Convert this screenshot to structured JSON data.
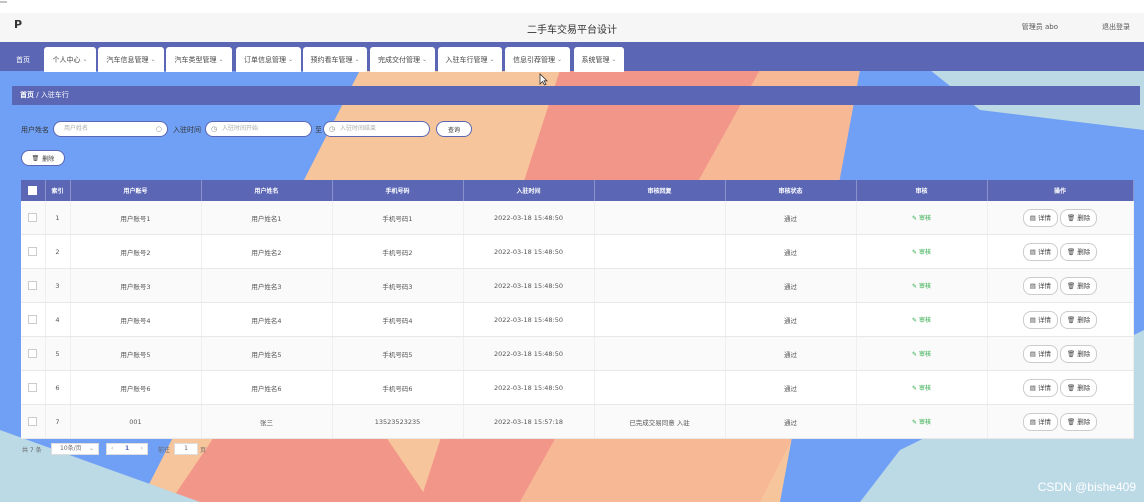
{
  "app": {
    "logo": "P",
    "title": "二手车交易平台设计",
    "admin_label": "管理员 abo",
    "logout_label": "退出登录"
  },
  "nav": {
    "items": [
      {
        "label": "首页",
        "has_chevron": false
      },
      {
        "label": "个人中心",
        "has_chevron": true
      },
      {
        "label": "汽车信息管理",
        "has_chevron": true
      },
      {
        "label": "汽车类型管理",
        "has_chevron": true
      },
      {
        "label": "订单信息管理",
        "has_chevron": true
      },
      {
        "label": "预约看车管理",
        "has_chevron": true
      },
      {
        "label": "完成交付管理",
        "has_chevron": true
      },
      {
        "label": "入驻车行管理",
        "has_chevron": true
      },
      {
        "label": "信息引荐管理",
        "has_chevron": true
      },
      {
        "label": "系统管理",
        "has_chevron": true
      }
    ]
  },
  "breadcrumb": {
    "home": "首页",
    "separator": "/",
    "current": "入驻车行"
  },
  "search": {
    "name_label": "用户姓名",
    "name_placeholder": "用户姓名",
    "time_label": "入驻时间",
    "start_placeholder": "入驻时间开始",
    "to_label": "至",
    "end_placeholder": "入驻时间结束",
    "query_button": "查询"
  },
  "actions": {
    "delete_label": "删除"
  },
  "table": {
    "columns": [
      "索引",
      "用户账号",
      "用户姓名",
      "手机号码",
      "入驻时间",
      "审核回复",
      "审核状态",
      "审核",
      "操作"
    ],
    "audit_label": "审核",
    "detail_label": "详情",
    "delete_label": "删除",
    "rows": [
      {
        "index": "1",
        "account": "用户账号1",
        "name": "用户姓名1",
        "phone": "手机号码1",
        "time": "2022-03-18 15:48:50",
        "reply": "",
        "status": "通过"
      },
      {
        "index": "2",
        "account": "用户账号2",
        "name": "用户姓名2",
        "phone": "手机号码2",
        "time": "2022-03-18 15:48:50",
        "reply": "",
        "status": "通过"
      },
      {
        "index": "3",
        "account": "用户账号3",
        "name": "用户姓名3",
        "phone": "手机号码3",
        "time": "2022-03-18 15:48:50",
        "reply": "",
        "status": "通过"
      },
      {
        "index": "4",
        "account": "用户账号4",
        "name": "用户姓名4",
        "phone": "手机号码4",
        "time": "2022-03-18 15:48:50",
        "reply": "",
        "status": "通过"
      },
      {
        "index": "5",
        "account": "用户账号5",
        "name": "用户姓名5",
        "phone": "手机号码5",
        "time": "2022-03-18 15:48:50",
        "reply": "",
        "status": "通过"
      },
      {
        "index": "6",
        "account": "用户账号6",
        "name": "用户姓名6",
        "phone": "手机号码6",
        "time": "2022-03-18 15:48:50",
        "reply": "",
        "status": "通过"
      },
      {
        "index": "7",
        "account": "001",
        "name": "张三",
        "phone": "13523523235",
        "time": "2022-03-18 15:57:18",
        "reply": "已完成交易同意 入驻",
        "status": "通过"
      }
    ]
  },
  "pagination": {
    "total": "共 7 条",
    "page_size": "10条/页",
    "current_page": "1",
    "goto_label": "前往",
    "goto_value": "1",
    "page_unit": "页"
  },
  "watermark": "CSDN @bishe409",
  "colors": {
    "primary": "#5b67b5",
    "audit_green": "#2aa845",
    "bg_blue": "#6fa0f5",
    "bg_peach": "#f7c59b",
    "bg_salmon": "#f2968a",
    "bg_lightblue": "#bcd9e6"
  },
  "icons": {
    "cursor": "mouse-pointer-icon",
    "search": "search-icon",
    "clock": "clock-icon",
    "trash": "trash-icon",
    "edit": "edit-icon",
    "detail": "detail-icon"
  }
}
